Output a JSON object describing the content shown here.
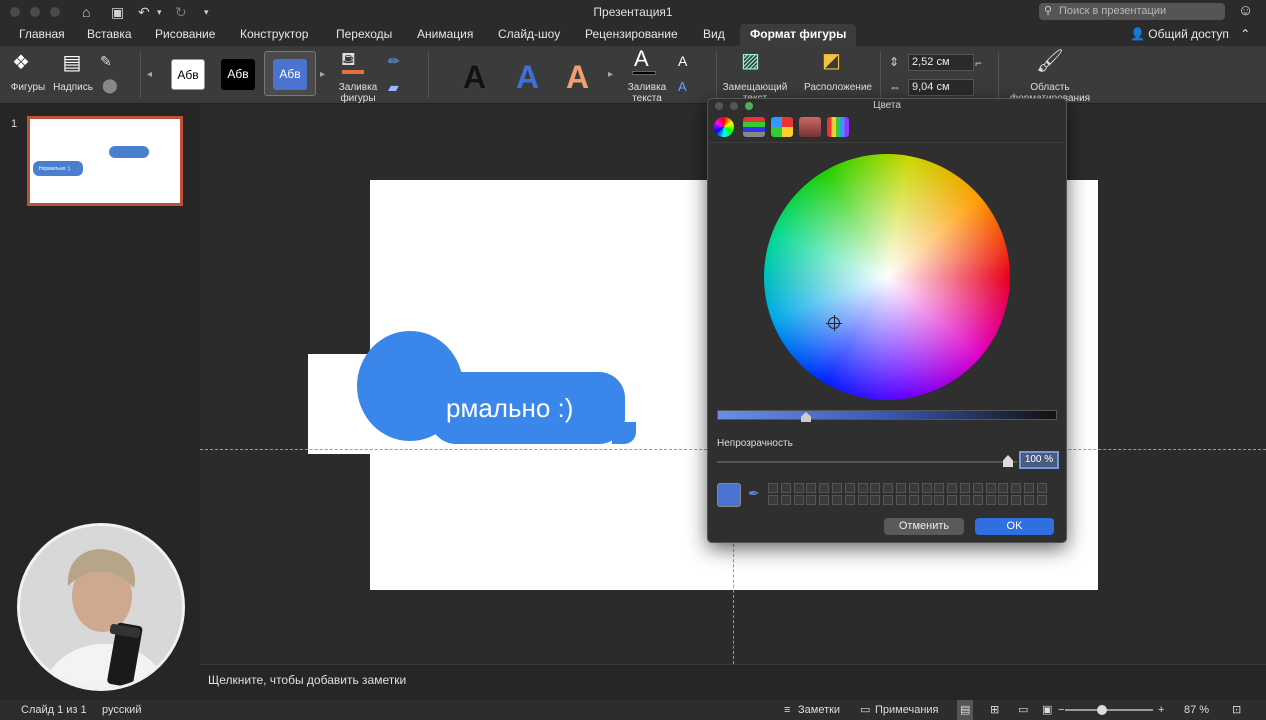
{
  "window": {
    "title": "Презентация1",
    "search_placeholder": "Поиск в презентации"
  },
  "tabs": [
    {
      "label": "Главная"
    },
    {
      "label": "Вставка"
    },
    {
      "label": "Рисование"
    },
    {
      "label": "Конструктор"
    },
    {
      "label": "Переходы"
    },
    {
      "label": "Анимация"
    },
    {
      "label": "Слайд-шоу"
    },
    {
      "label": "Рецензирование"
    },
    {
      "label": "Вид"
    },
    {
      "label": "Формат фигуры",
      "active": true
    }
  ],
  "share_label": "Общий доступ",
  "ribbon": {
    "shapes_label": "Фигуры",
    "textbox_label": "Надпись",
    "style_presets": [
      "Абв",
      "Абв",
      "Абв"
    ],
    "shape_fill_label1": "Заливка",
    "shape_fill_label2": "фигуры",
    "wordart_letters": [
      "A",
      "A",
      "A"
    ],
    "text_fill_label1": "Заливка",
    "text_fill_label2": "текста",
    "alt_text_label1": "Замещающий",
    "alt_text_label2": "текст",
    "arrange_label": "Расположение",
    "height_value": "2,52 см",
    "width_value": "9,04 см",
    "format_pane_label1": "Область",
    "format_pane_label2": "форматирования"
  },
  "slides_panel": {
    "slide_number": "1",
    "thumb_text": "Нормально :)"
  },
  "slide": {
    "bubble_text": "рмально :)"
  },
  "notes_placeholder": "Щелкните, чтобы добавить заметки",
  "status": {
    "slide_info": "Слайд 1 из 1",
    "language": "русский",
    "notes_label": "Заметки",
    "comments_label": "Примечания",
    "zoom": "87 %"
  },
  "colors_dialog": {
    "title": "Цвета",
    "opacity_label": "Непрозрачность",
    "opacity_value": "100 %",
    "cancel_label": "Отменить",
    "ok_label": "OK",
    "current_color": "#4a74d0"
  },
  "colors": {
    "accent": "#3a86ea",
    "thumb_border": "#c0503a",
    "ok_button": "#2f6fe0"
  }
}
